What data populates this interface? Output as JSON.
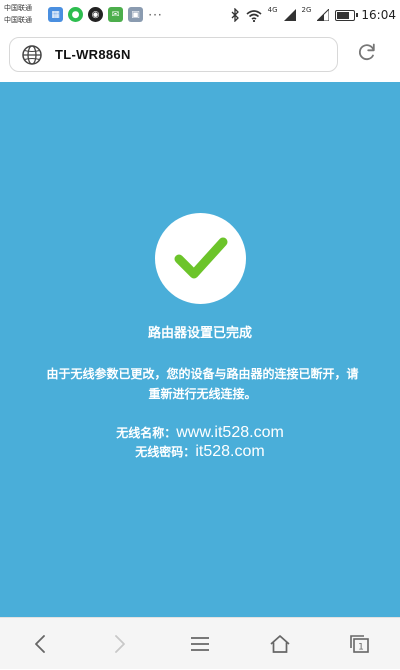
{
  "status_bar": {
    "carrier_line1": "中国联通",
    "carrier_line2": "中国联通",
    "notification_more": "···",
    "net_tag_1": "4G",
    "net_tag_2": "2G",
    "time": "16:04"
  },
  "browser": {
    "url": "TL-WR886N"
  },
  "page": {
    "title": "路由器设置已完成",
    "message": "由于无线参数已更改，您的设备与路由器的连接已断开，请重新进行无线连接。",
    "ssid_label": "无线名称：",
    "ssid_value": "www.it528.com",
    "password_label": "无线密码：",
    "password_value": "it528.com"
  },
  "colors": {
    "page_background": "#4aaed9",
    "check_color": "#6cc42a"
  },
  "icons": {
    "address": "globe-icon",
    "reload": "reload-icon",
    "back": "back-arrow-icon",
    "forward": "forward-arrow-icon",
    "menu": "menu-icon",
    "home": "home-icon",
    "tabs": "tabs-icon",
    "success": "checkmark-icon"
  }
}
